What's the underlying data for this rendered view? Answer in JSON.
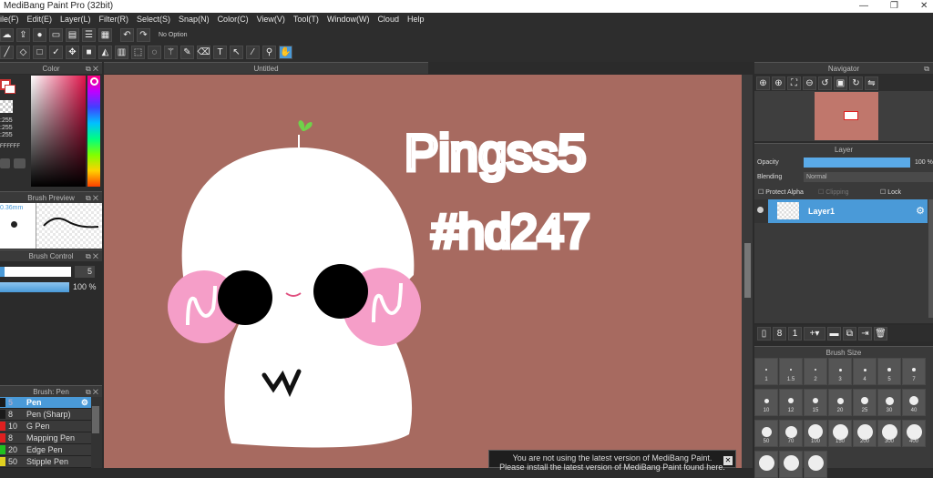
{
  "window": {
    "title": "MediBang Paint Pro (32bit)",
    "controls": [
      "—",
      "❐",
      "✕"
    ]
  },
  "menu": [
    "ile(F)",
    "Edit(E)",
    "Layer(L)",
    "Filter(R)",
    "Select(S)",
    "Snap(N)",
    "Color(C)",
    "View(V)",
    "Tool(T)",
    "Window(W)",
    "Cloud",
    "Help"
  ],
  "toolbar1": {
    "option_text": "No Option"
  },
  "color_panel": {
    "title": "Color",
    "r": ":255",
    "g": ":255",
    "b": ":255",
    "hex": "FFFFFF"
  },
  "brush_preview": {
    "title": "Brush Preview",
    "size": "0.36mm"
  },
  "brush_control": {
    "title": "Brush Control",
    "size_value": "5",
    "opacity_value": "100 %",
    "opacity_percent": 100
  },
  "brush_list": {
    "title": "Brush: Pen",
    "items": [
      {
        "size": "5",
        "name": "Pen",
        "color": "#1a1a1a",
        "selected": true
      },
      {
        "size": "8",
        "name": "Pen (Sharp)",
        "color": "#1a1a1a"
      },
      {
        "size": "10",
        "name": "G Pen",
        "color": "#e02020"
      },
      {
        "size": "8",
        "name": "Mapping Pen",
        "color": "#e02020"
      },
      {
        "size": "20",
        "name": "Edge Pen",
        "color": "#20c020"
      },
      {
        "size": "50",
        "name": "Stipple Pen",
        "color": "#e0d020"
      }
    ]
  },
  "document": {
    "tab": "Untitled",
    "canvas_color": "#a76a60",
    "drawing_text_1": "Pingss5",
    "drawing_text_2": "#hd247"
  },
  "navigator": {
    "title": "Navigator"
  },
  "layer_panel": {
    "title": "Layer",
    "opacity_label": "Opacity",
    "opacity_value": "100 %",
    "opacity_percent": 100,
    "blending_label": "Blending",
    "blending_value": "Normal",
    "protect_alpha": "Protect Alpha",
    "clipping": "Clipping",
    "lock": "Lock",
    "layers": [
      {
        "name": "Layer1"
      }
    ]
  },
  "brush_size": {
    "title": "Brush Size",
    "sizes": [
      "1",
      "1.5",
      "2",
      "3",
      "4",
      "5",
      "7",
      "10",
      "12",
      "15",
      "20",
      "25",
      "30",
      "40",
      "50",
      "70",
      "100",
      "150",
      "200",
      "300",
      "400",
      "",
      "",
      ""
    ]
  },
  "notification": {
    "line1": "You are not using the latest version of MediBang Paint.",
    "line2": "Please install the latest version of MediBang Paint found here."
  }
}
